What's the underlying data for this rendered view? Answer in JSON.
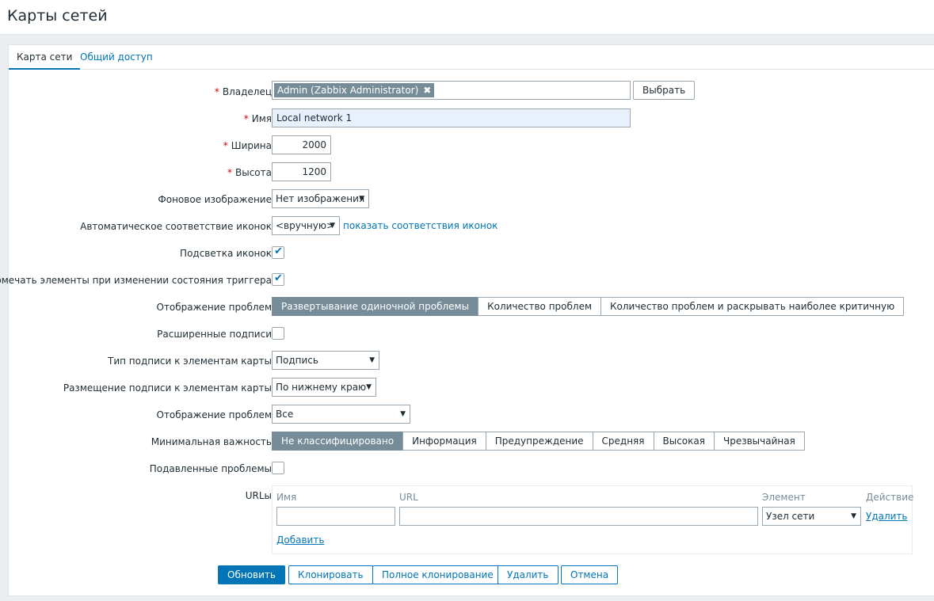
{
  "header": {
    "title": "Карты сетей"
  },
  "tabs": [
    {
      "label": "Карта сети"
    },
    {
      "label": "Общий доступ"
    }
  ],
  "form": {
    "owner": {
      "label": "Владелец",
      "required_mark": "*",
      "tag": "Admin (Zabbix Administrator)",
      "remove_glyph": "✖",
      "select_button": "Выбрать"
    },
    "name": {
      "label": "Имя",
      "required_mark": "*",
      "value": "Local network 1"
    },
    "width": {
      "label": "Ширина",
      "required_mark": "*",
      "value": "2000"
    },
    "height": {
      "label": "Высота",
      "required_mark": "*",
      "value": "1200"
    },
    "background": {
      "label": "Фоновое изображение",
      "value": "Нет изображения"
    },
    "iconmap": {
      "label": "Автоматическое соответствие иконок",
      "value": "<вручную>",
      "link": "показать соответствия иконок"
    },
    "highlight": {
      "label": "Подсветка иконок",
      "checked": true
    },
    "markelements": {
      "label": "Помечать элементы при изменении состояния триггера",
      "checked": true
    },
    "problem_display": {
      "label": "Отображение проблем",
      "options": [
        "Развертывание одиночной проблемы",
        "Количество проблем",
        "Количество проблем и раскрывать наиболее критичную"
      ],
      "selected": 0
    },
    "advanced_labels": {
      "label": "Расширенные подписи",
      "checked": false
    },
    "label_type": {
      "label": "Тип подписи к элементам карты",
      "value": "Подпись"
    },
    "label_location": {
      "label": "Размещение подписи к элементам карты",
      "value": "По нижнему краю"
    },
    "show_problems": {
      "label": "Отображение проблем",
      "value": "Все"
    },
    "min_severity": {
      "label": "Минимальная важность",
      "options": [
        "Не классифицировано",
        "Информация",
        "Предупреждение",
        "Средняя",
        "Высокая",
        "Чрезвычайная"
      ],
      "selected": 0
    },
    "suppressed": {
      "label": "Подавленные проблемы",
      "checked": false
    },
    "urls": {
      "label": "URLы",
      "col_name": "Имя",
      "col_url": "URL",
      "col_element": "Элемент",
      "col_action": "Действие",
      "row": {
        "name": "",
        "url": "",
        "element": "Узел сети",
        "action": "Удалить"
      },
      "add": "Добавить"
    }
  },
  "actions": {
    "update": "Обновить",
    "clone": "Клонировать",
    "full_clone": "Полное клонирование",
    "delete": "Удалить",
    "cancel": "Отмена"
  },
  "glyphs": {
    "check": "✔",
    "dropdown": "▼"
  },
  "colors": {
    "accent": "#0275b8",
    "selected_segment": "#768d99",
    "required": "#d40000"
  }
}
